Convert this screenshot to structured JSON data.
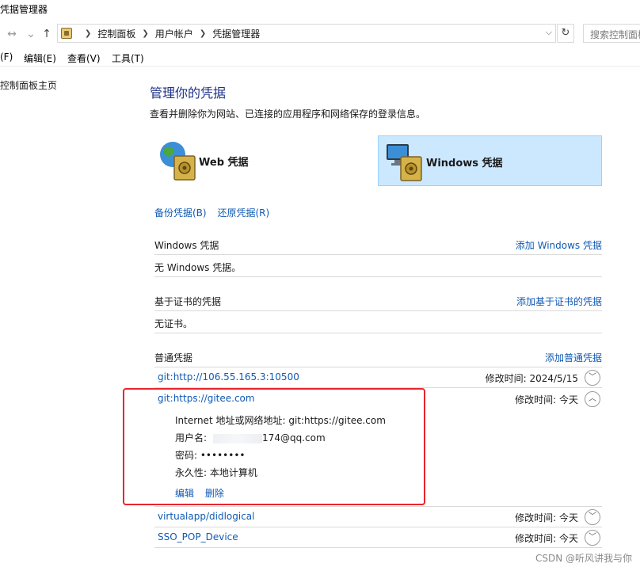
{
  "window": {
    "title": "凭据管理器"
  },
  "nav": {
    "back": "←",
    "forward": "→",
    "recent": "⌄",
    "up": "↑",
    "breadcrumbs": [
      "控制面板",
      "用户帐户",
      "凭据管理器"
    ],
    "refresh": "↻",
    "search_placeholder": "搜索控制面板"
  },
  "menu": {
    "file": "(F)",
    "edit": "编辑(E)",
    "view": "查看(V)",
    "tools": "工具(T)"
  },
  "sidebar": {
    "home_link": "控制面板主页"
  },
  "main": {
    "title": "管理你的凭据",
    "description": "查看并删除你为网站、已连接的应用程序和网络保存的登录信息。",
    "categories": {
      "web": "Web 凭据",
      "windows": "Windows 凭据"
    },
    "backup": "备份凭据(B)",
    "restore": "还原凭据(R)"
  },
  "sections": {
    "windows": {
      "heading": "Windows 凭据",
      "add": "添加 Windows 凭据",
      "empty": "无 Windows 凭据。"
    },
    "cert": {
      "heading": "基于证书的凭据",
      "add": "添加基于证书的凭据",
      "empty": "无证书。"
    },
    "generic": {
      "heading": "普通凭据",
      "add": "添加普通凭据"
    }
  },
  "credentials": [
    {
      "name": "git:http://106.55.165.3:10500",
      "modified": "修改时间:  2024/5/15"
    },
    {
      "name": "git:https://gitee.com",
      "modified": "修改时间:  今天",
      "address_line": "Internet 地址或网络地址:  git:https://gitee.com",
      "user_label": "用户名:",
      "user_value": "174@qq.com",
      "password_line": "密码:  ••••••••",
      "persistence_line": "永久性:  本地计算机",
      "edit": "编辑",
      "delete": "删除"
    },
    {
      "name": "virtualapp/didlogical",
      "modified": "修改时间:  今天"
    },
    {
      "name": "SSO_POP_Device",
      "modified": "修改时间:  今天"
    }
  ],
  "watermark": "CSDN @听风讲我与你",
  "colors": {
    "link": "#0f5ab5",
    "title": "#1e3287",
    "selected": "#cce8ff",
    "highlight": "#e8262d"
  }
}
